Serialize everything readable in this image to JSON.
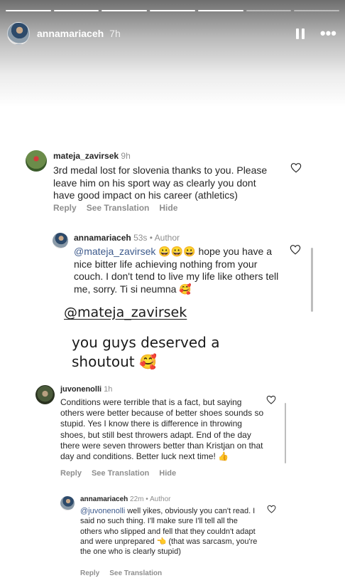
{
  "story": {
    "username": "annamariaceh",
    "time": "7h",
    "progress_segments": 7,
    "progress_done": 5
  },
  "comments": [
    {
      "username": "mateja_zavirsek",
      "time": "9h",
      "text": "3rd medal lost for slovenia thanks to you. Please leave him on his sport way as clearly you dont have good impact on his career (athletics)",
      "actions": [
        "Reply",
        "See Translation",
        "Hide"
      ]
    },
    {
      "username": "annamariaceh",
      "time": "53s",
      "role": "Author",
      "mention": "@mateja_zavirsek",
      "text": "😀😀😀 hope you have a nice bitter life achieving nothing from your couch. I don't tend to live my life like others tell me, sorry. Ti si neumna 🥰"
    },
    {
      "username": "juvonenolli",
      "time": "1h",
      "text": "Conditions were terrible that is a fact, but saying others were better because of better shoes sounds so stupid. Yes I know there is difference in throwing shoes, but still best throwers adapt. End of the day there were seven throwers better than Kristjan on that day and conditions. Better luck next time! 👍",
      "actions": [
        "Reply",
        "See Translation",
        "Hide"
      ]
    },
    {
      "username": "annamariaceh",
      "time": "22m",
      "role": "Author",
      "mention": "@juvonenolli",
      "text": "well yikes, obviously you can't read. I said no such thing. I'll make sure I'll tell all the others who slipped and fell that they couldn't adapt and were unprepared 👈 (that was sarcasm, you're the one who is clearly stupid)",
      "actions": [
        "Reply",
        "See Translation"
      ]
    }
  ],
  "overlay": {
    "mention": "@mateja_zavirsek",
    "shoutout": "you guys deserved a shoutout 🥰"
  },
  "colors": {
    "mention": "#3d5a8c",
    "meta": "#8e8e8e"
  }
}
